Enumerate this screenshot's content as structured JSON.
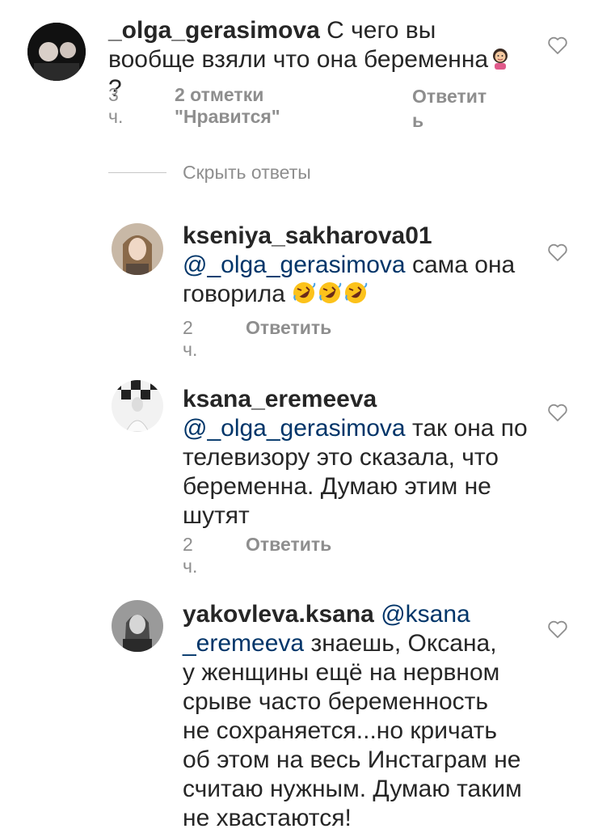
{
  "comments": [
    {
      "username": "_olga_gerasimova",
      "text": "С чего вы вообще взяли что она беременна",
      "text_tail": "?",
      "time": "3 ч.",
      "likes": "2 отметки \"Нравится\"",
      "reply_line1": "Ответит",
      "reply_line2": "ь"
    },
    {
      "username": "kseniya_sakharova01",
      "mention": "@_olga_gerasimova",
      "text_line1": "сама она",
      "text_line2": "говорила",
      "time": "2 ч.",
      "reply": "Ответить"
    },
    {
      "username": "ksana_eremeeva",
      "mention": "@_olga_gerasimova",
      "text_line1": "так она по",
      "text_line2": "телевизору это сказала, что",
      "text_line3": "беременна. Думаю этим не",
      "text_line4": "шутят",
      "time": "2 ч.",
      "reply": "Ответить"
    },
    {
      "username": "yakovleva.ksana",
      "mention_line1": "@ksana",
      "mention_line2": "_eremeeva",
      "text_line1": "знаешь, Оксана,",
      "text_line2": "у женщины ещё на нервном",
      "text_line3": "срыве часто беременность",
      "text_line4": "не сохраняется...но кричать",
      "text_line5": "об этом на весь Инстаграм не",
      "text_line6": "считаю нужным. Думаю таким",
      "text_line7": "не хвастаются!"
    }
  ],
  "hide_replies": "Скрыть ответы",
  "icons": {
    "like": "heart-outline-icon",
    "emoji_1": "person-gesturing-emoji",
    "emoji_2": "rofl-emoji"
  },
  "colors": {
    "text": "#262626",
    "meta": "#8e8e8e",
    "mention": "#003569",
    "divider": "#c7c7c7"
  }
}
